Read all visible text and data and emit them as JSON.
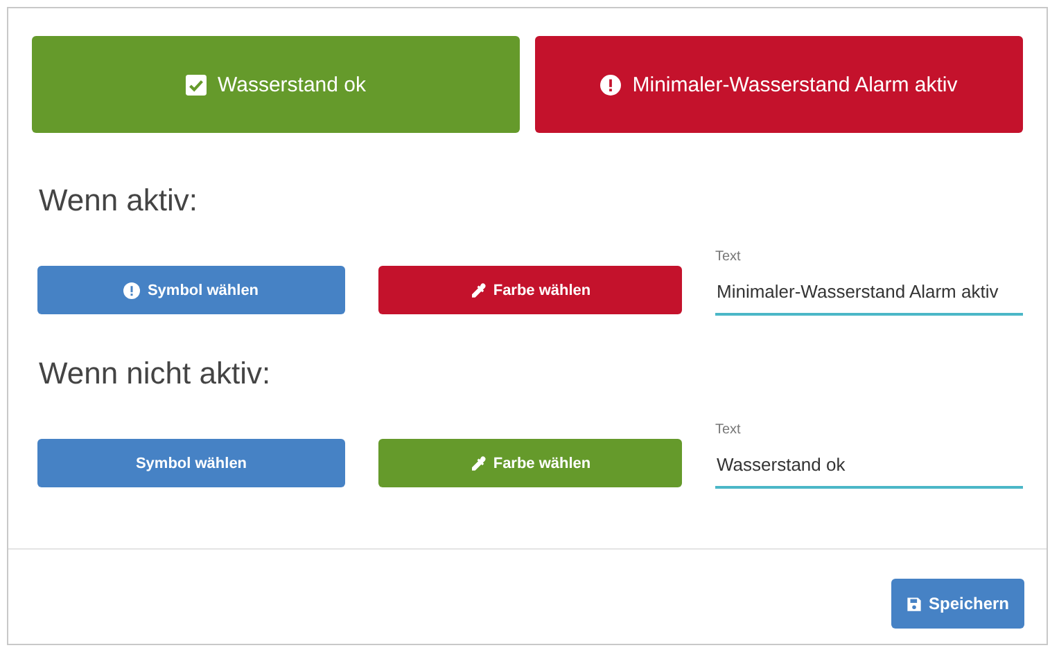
{
  "preview": [
    {
      "text": "Wasserstand ok",
      "kind": "check",
      "color": "#659a2b"
    },
    {
      "text": "Minimaler-Wasserstand Alarm aktiv",
      "kind": "alert",
      "color": "#c4122c"
    }
  ],
  "sections": [
    {
      "heading": "Wenn aktiv:",
      "symbol_button": {
        "label": "Symbol wählen",
        "kind": "alert"
      },
      "color_button": {
        "label": "Farbe wählen",
        "color": "#c4122c"
      },
      "text_field": {
        "label": "Text",
        "value": "Minimaler-Wasserstand Alarm aktiv"
      }
    },
    {
      "heading": "Wenn nicht aktiv:",
      "symbol_button": {
        "label": "Symbol wählen",
        "kind": "plain"
      },
      "color_button": {
        "label": "Farbe wählen",
        "color": "#659a2b"
      },
      "text_field": {
        "label": "Text",
        "value": "Wasserstand ok"
      }
    }
  ],
  "save_button": {
    "label": "Speichern"
  }
}
